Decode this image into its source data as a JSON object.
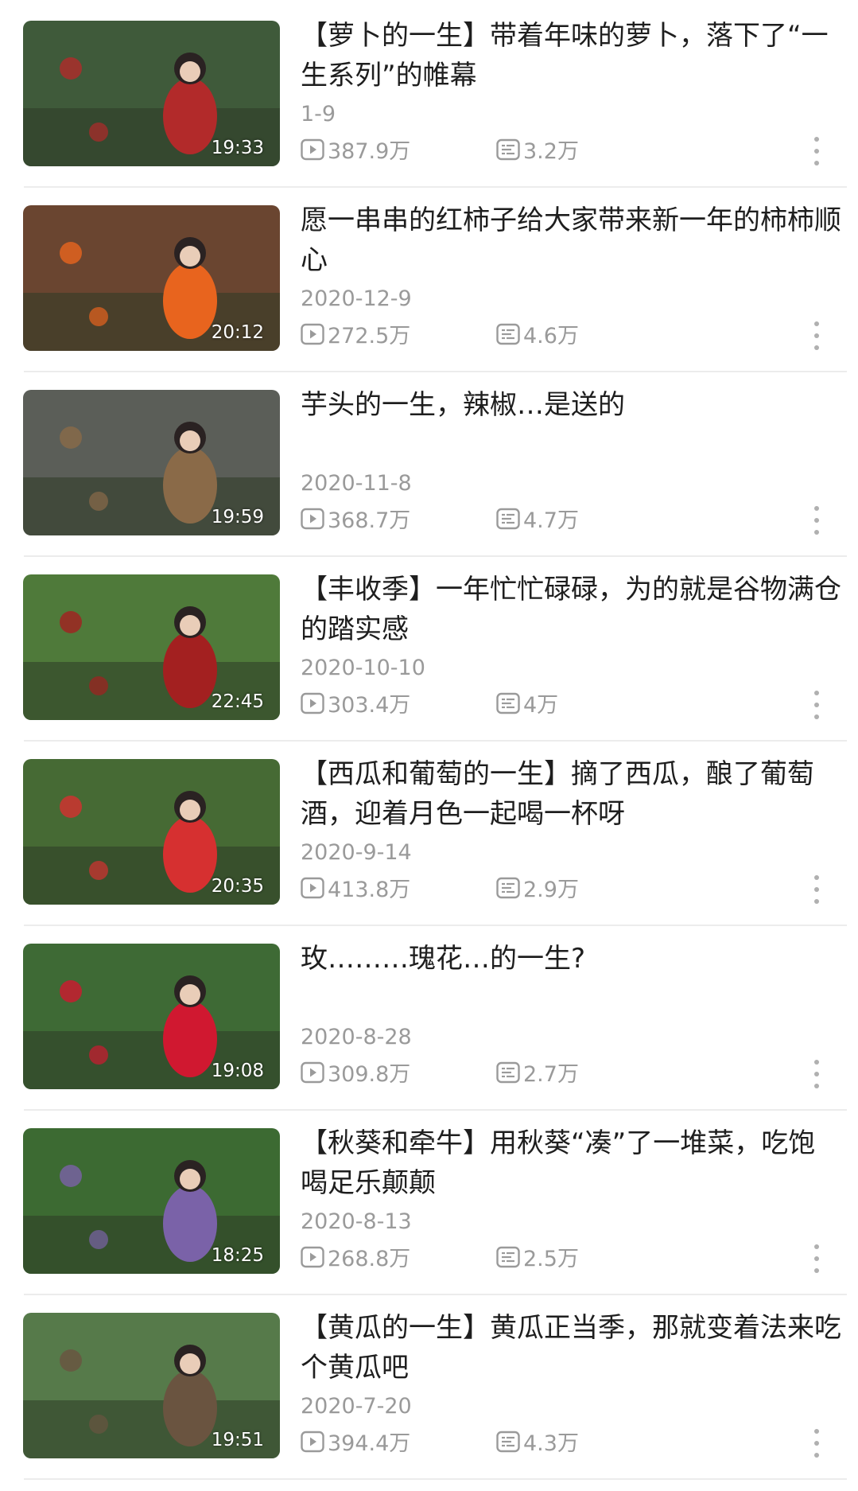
{
  "videos": [
    {
      "title": "【萝卜的一生】带着年味的萝卜，落下了“一生系列”的帷幕",
      "date": "1-9",
      "duration": "19:33",
      "views": "387.9万",
      "danmaku": "3.2万",
      "palette": "#3f5a3a",
      "accent": "#b22a2a"
    },
    {
      "title": "愿一串串的红柿子给大家带来新一年的柿柿顺心",
      "date": "2020-12-9",
      "duration": "20:12",
      "views": "272.5万",
      "danmaku": "4.6万",
      "palette": "#6a4530",
      "accent": "#e8641e"
    },
    {
      "title": "芋头的一生，辣椒…是送的",
      "date": "2020-11-8",
      "duration": "19:59",
      "views": "368.7万",
      "danmaku": "4.7万",
      "palette": "#5b5e58",
      "accent": "#8a6a48"
    },
    {
      "title": "【丰收季】一年忙忙碌碌，为的就是谷物满仓的踏实感",
      "date": "2020-10-10",
      "duration": "22:45",
      "views": "303.4万",
      "danmaku": "4万",
      "palette": "#4f7a3a",
      "accent": "#a32020"
    },
    {
      "title": "【西瓜和葡萄的一生】摘了西瓜，酿了葡萄酒，迎着月色一起喝一杯呀",
      "date": "2020-9-14",
      "duration": "20:35",
      "views": "413.8万",
      "danmaku": "2.9万",
      "palette": "#466a34",
      "accent": "#d63030"
    },
    {
      "title": "玫………瑰花…的一生?",
      "date": "2020-8-28",
      "duration": "19:08",
      "views": "309.8万",
      "danmaku": "2.7万",
      "palette": "#3e6a35",
      "accent": "#d01830"
    },
    {
      "title": "【秋葵和牵牛】用秋葵“凑”了一堆菜，吃饱喝足乐颠颠",
      "date": "2020-8-13",
      "duration": "18:25",
      "views": "268.8万",
      "danmaku": "2.5万",
      "palette": "#3c6a32",
      "accent": "#7a62a8"
    },
    {
      "title": "【黄瓜的一生】黄瓜正当季，那就变着法来吃个黄瓜吧",
      "date": "2020-7-20",
      "duration": "19:51",
      "views": "394.4万",
      "danmaku": "4.3万",
      "palette": "#567a4a",
      "accent": "#6a5440"
    }
  ],
  "icons": {
    "views": "play-icon",
    "danmaku": "danmaku-icon",
    "more": "more-vertical-icon"
  }
}
